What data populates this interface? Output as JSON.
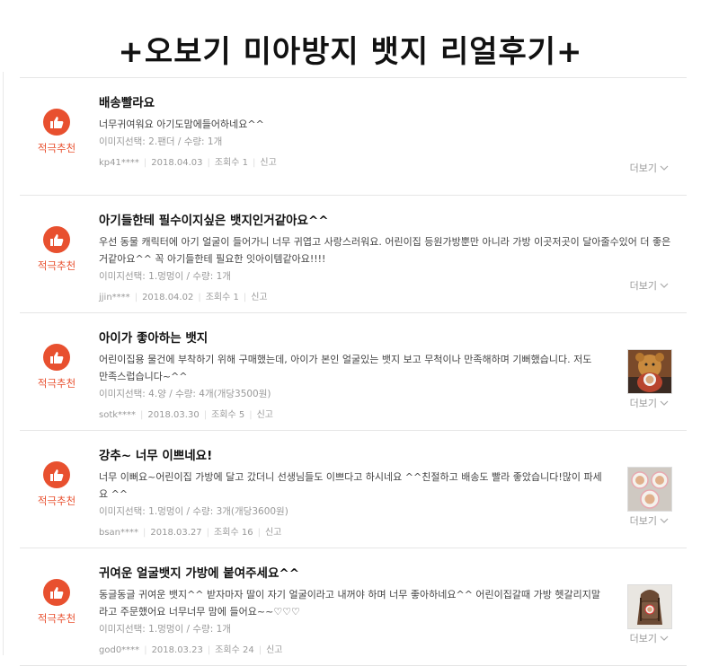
{
  "page": {
    "title": "+오보기 미아방지 뱃지 리얼후기+"
  },
  "labels": {
    "more": "더보기",
    "report": "신고"
  },
  "reviews": [
    {
      "badge": "적극추천",
      "title": "배송빨라요",
      "text": "너무귀여워요 아기도맘에들어하네요^^",
      "option": "이미지선택: 2.팬더 / 수량: 1개",
      "author": "kp41****",
      "date": "2018.04.03",
      "views": "조회수 1",
      "report": "신고",
      "has_photo": false
    },
    {
      "badge": "적극추천",
      "title": "아기들한테 필수이지싶은 뱃지인거같아요^^",
      "text": "우선 동물 캐릭터에 아기 얼굴이 들어가니 너무 귀엽고 사랑스러워요. 어린이집 등원가방뿐만 아니라 가방 이곳저곳이 달아줄수있어 더 좋은거같아요^^ 꼭 아기들한테 필요한 잇아이템같아요!!!!",
      "option": "이미지선택: 1.멍멍이 / 수량: 1개",
      "author": "jjin****",
      "date": "2018.04.02",
      "views": "조회수 1",
      "report": "신고",
      "has_photo": false
    },
    {
      "badge": "적극추천",
      "title": "아이가 좋아하는 뱃지",
      "text": "어린이집용 물건에 부착하기 위해 구매했는데, 아이가 본인 얼굴있는 뱃지 보고 무척이나 만족해하며 기뻐했습니다. 저도 만족스럽습니다~^^",
      "option": "이미지선택: 4.양 / 수량: 4개(개당3500원)",
      "author": "sotk****",
      "date": "2018.03.30",
      "views": "조회수 5",
      "report": "신고",
      "has_photo": true,
      "photo_icon": "bear-doll-photo-icon"
    },
    {
      "badge": "적극추천",
      "title": "강추~ 너무 이쁘네요!",
      "text": "너무 이뻐요~어린이집 가방에 달고 갔더니 선생님들도 이쁘다고 하시네요 ^^친절하고 배송도 빨라 좋았습니다!많이 파세요 ^^",
      "option": "이미지선택: 1.멍멍이 / 수량: 3개(개당3600원)",
      "author": "bsan****",
      "date": "2018.03.27",
      "views": "조회수 16",
      "report": "신고",
      "has_photo": true,
      "photo_icon": "badges-photo-icon"
    },
    {
      "badge": "적극추천",
      "title": "귀여운 얼굴뱃지 가방에 붙여주세요^^",
      "text": "동글동글 귀여운 뱃지^^ 받자마자 딸이 자기 얼굴이라고 내꺼야 하며 너무 좋아하네요^^ 어린이집갈때 가방 헷갈리지말라고 주문했어요 너무너무 맘에 들어요~~♡♡♡",
      "option": "이미지선택: 1.멍멍이 / 수량: 1개",
      "author": "god0****",
      "date": "2018.03.23",
      "views": "조회수 24",
      "report": "신고",
      "has_photo": true,
      "photo_icon": "backpack-photo-icon"
    }
  ]
}
